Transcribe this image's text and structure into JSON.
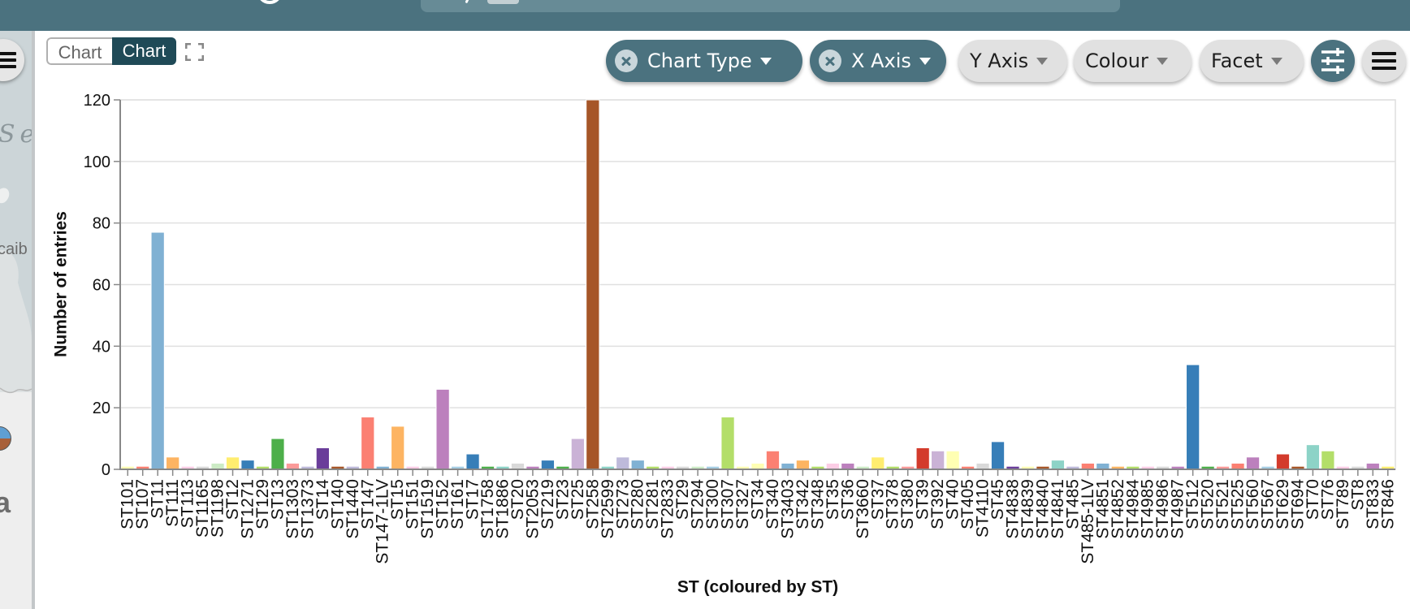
{
  "map_panel": {
    "sea_label": "Se",
    "place_label": "caib",
    "letter_label": "a"
  },
  "view_toggle": {
    "options": [
      {
        "label": "Chart",
        "active": false
      },
      {
        "label": "Chart",
        "active": true
      }
    ]
  },
  "toolbar": {
    "pills": [
      {
        "label": "Chart Type",
        "active": true
      },
      {
        "label": "X Axis",
        "active": true
      },
      {
        "label": "Y Axis",
        "active": false
      },
      {
        "label": "Colour",
        "active": false
      },
      {
        "label": "Facet",
        "active": false
      }
    ]
  },
  "chart_data": {
    "type": "bar",
    "title": "",
    "xlabel": "ST (coloured by ST)",
    "ylabel": "Number of entries",
    "ylim": [
      0,
      120
    ],
    "yticks": [
      0,
      20,
      40,
      60,
      80,
      100,
      120
    ],
    "grid": true,
    "legend": "none",
    "categories": [
      "ST101",
      "ST107",
      "ST11",
      "ST111",
      "ST113",
      "ST1165",
      "ST1198",
      "ST12",
      "ST1271",
      "ST129",
      "ST13",
      "ST1303",
      "ST1373",
      "ST14",
      "ST140",
      "ST1440",
      "ST147",
      "ST147-1LV",
      "ST15",
      "ST151",
      "ST1519",
      "ST152",
      "ST161",
      "ST17",
      "ST1758",
      "ST1886",
      "ST20",
      "ST2053",
      "ST219",
      "ST23",
      "ST25",
      "ST258",
      "ST2599",
      "ST273",
      "ST280",
      "ST281",
      "ST2833",
      "ST29",
      "ST294",
      "ST300",
      "ST307",
      "ST327",
      "ST34",
      "ST340",
      "ST3403",
      "ST342",
      "ST348",
      "ST35",
      "ST36",
      "ST3660",
      "ST37",
      "ST378",
      "ST380",
      "ST39",
      "ST392",
      "ST40",
      "ST405",
      "ST4110",
      "ST45",
      "ST4838",
      "ST4839",
      "ST4840",
      "ST4841",
      "ST485",
      "ST485-1LV",
      "ST4851",
      "ST4852",
      "ST4984",
      "ST4985",
      "ST4986",
      "ST4987",
      "ST512",
      "ST520",
      "ST521",
      "ST525",
      "ST560",
      "ST567",
      "ST629",
      "ST694",
      "ST70",
      "ST76",
      "ST789",
      "ST8",
      "ST833",
      "ST846"
    ],
    "values": [
      1,
      1,
      77,
      4,
      1,
      1,
      2,
      4,
      3,
      1,
      10,
      2,
      1,
      7,
      1,
      1,
      17,
      1,
      14,
      1,
      1,
      26,
      1,
      5,
      1,
      1,
      2,
      1,
      3,
      1,
      10,
      120,
      1,
      4,
      3,
      1,
      1,
      1,
      1,
      1,
      17,
      1,
      2,
      6,
      2,
      3,
      1,
      2,
      2,
      1,
      4,
      1,
      1,
      7,
      6,
      6,
      1,
      2,
      9,
      1,
      1,
      1,
      3,
      1,
      2,
      2,
      1,
      1,
      1,
      1,
      1,
      34,
      1,
      1,
      2,
      4,
      1,
      5,
      1,
      8,
      6,
      1,
      1,
      2,
      1
    ],
    "colors": [
      "#ffffb3",
      "#fb8072",
      "#80b1d3",
      "#fdb462",
      "#fccde5",
      "#d9d9d9",
      "#ccebc5",
      "#ffed6f",
      "#377eb8",
      "#b3de69",
      "#4daf4a",
      "#fb9a99",
      "#bebada",
      "#6a3d9a",
      "#a65628",
      "#bebada",
      "#fb8072",
      "#80b1d3",
      "#fdb462",
      "#fccde5",
      "#d9d9d9",
      "#bc80bd",
      "#a6cee3",
      "#377eb8",
      "#4daf4a",
      "#8dd3c7",
      "#d9d9d9",
      "#bc80bd",
      "#377eb8",
      "#4daf4a",
      "#cab2d6",
      "#a65628",
      "#8dd3c7",
      "#bebada",
      "#80b1d3",
      "#b3de69",
      "#fccde5",
      "#d9d9d9",
      "#ccebc5",
      "#a6cee3",
      "#b3de69",
      "#ffffb3",
      "#ffffb3",
      "#fb8072",
      "#80b1d3",
      "#fdb462",
      "#b3de69",
      "#fccde5",
      "#bc80bd",
      "#ccebc5",
      "#ffed6f",
      "#b3de69",
      "#fb9a99",
      "#d33b2c",
      "#cab2d6",
      "#ffffb3",
      "#fb8072",
      "#d9d9d9",
      "#377eb8",
      "#6a3d9a",
      "#ffffb3",
      "#a65628",
      "#8dd3c7",
      "#bebada",
      "#fb8072",
      "#80b1d3",
      "#fdb462",
      "#b3de69",
      "#fccde5",
      "#d9d9d9",
      "#bc80bd",
      "#377eb8",
      "#4daf4a",
      "#fb9a99",
      "#fb8072",
      "#bc80bd",
      "#a6cee3",
      "#d33b2c",
      "#a65628",
      "#8dd3c7",
      "#b3de69",
      "#fccde5",
      "#d9d9d9",
      "#bc80bd",
      "#ffed6f"
    ]
  }
}
